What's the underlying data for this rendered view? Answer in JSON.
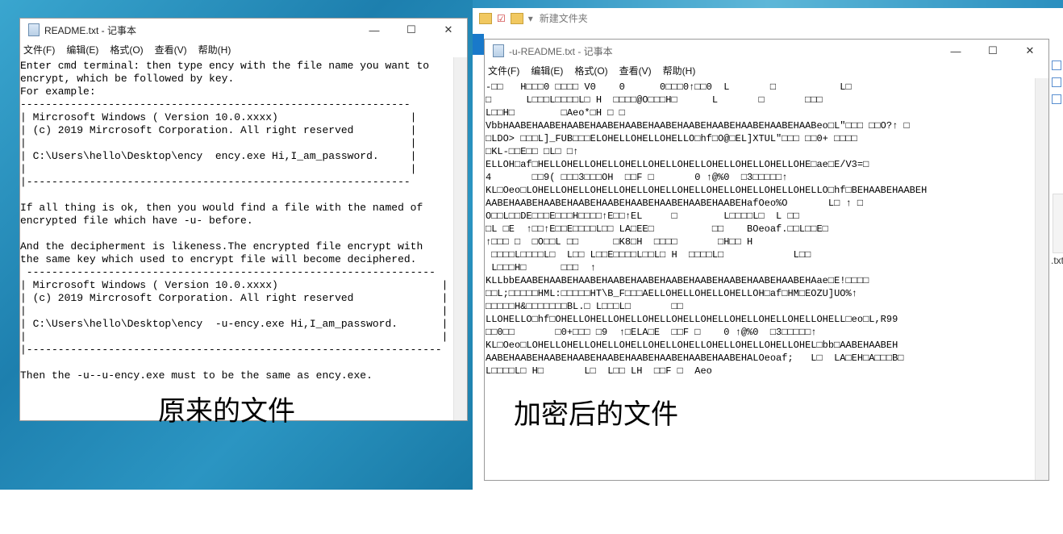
{
  "left_window": {
    "title": "README.txt - 记事本",
    "menu": [
      "文件(F)",
      "编辑(E)",
      "格式(O)",
      "查看(V)",
      "帮助(H)"
    ],
    "text": "Enter cmd terminal: then type ency with the file name you want to\nencrypt, which be followed by key.\nFor example:\n--------------------------------------------------------------\n| Mircrosoft Windows ( Version 10.0.xxxx)                     |\n| (c) 2019 Mircrosoft Corporation. All right reserved         |\n|                                                             |\n| C:\\Users\\hello\\Desktop\\ency  ency.exe Hi,I_am_password.     |\n|                                                             |\n|-------------------------------------------------------------\n\nIf all thing is ok, then you would find a file with the named of\nencrypted file which have -u- before.\n\nAnd the decipherment is likeness.The encrypted file encrypt with\nthe same key which used to encrypt file will become deciphered.\n -----------------------------------------------------------------\n| Mircrosoft Windows ( Version 10.0.xxxx)                          |\n| (c) 2019 Mircrosoft Corporation. All right reserved              |\n|                                                                  |\n| C:\\Users\\hello\\Desktop\\ency  -u-ency.exe Hi,I_am_password.       |\n|                                                                  |\n|------------------------------------------------------------------\n\nThen the -u--u-ency.exe must to be the same as ency.exe.",
    "caption": "原来的文件"
  },
  "right_window": {
    "title": "-u-README.txt - 记事本",
    "menu": [
      "文件(F)",
      "编辑(E)",
      "格式(O)",
      "查看(V)",
      "帮助(H)"
    ],
    "text": "-□□   H□□□0 □□□□ V0    0      0□□□0↑□□0  L       □           L□\n□      L□□□L□□□□L□ H  □□□□@O□□□H□      L       □       □□□\nL□□H□        □Aeo*□H □ □\nVbbHAABEHAABEHAABEHAABEHAABEHAABEHAABEHAABEHAABEHAABEHAABeo□L\"□□□ □□O?↑ □\n□LDO> □□□L]_FUB□□□ELOHELLOHELLOHELLO□hf□O@□EL]XTUL\"□□□ □□0+ □□□□\n□KL-□□E□□ □L□ □↑\nELLOH□af□HELLOHELLOHELLOHELLOHELLOHELLOHELLOHELLOHELLOHE□ae□E/V3=□\n4       □□9( □□□3□□□OH  □□F □       0 ↑@%0  □3□□□□□↑\nKL□Oeo□LOHELLOHELLOHELLOHELLOHELLOHELLOHELLOHELLOHELLOHELLO□hf□BEHAABEHAABEH\nAABEHAABEHAABEHAABEHAABEHAABEHAABEHAABEHAABEHafOeo%O       L□ ↑ □\nO□□L□□DE□□□E□□□H□□□□↑E□□↑EL     □        L□□□□L□  L □□\n□L □E  ↑□□↑E□□E□□□□L□□ LA□EE□          □□    BOeoaf.□□L□□E□\n↑□□□ □  □O□□L □□      □K8□H  □□□□       □H□□ H\n □□□□L□□□□L□  L□□ L□□E□□□□L□□L□ H  □□□□L□            L□□\n L□□□H□      □□□  ↑\nKLLbbEAABEHAABEHAABEHAABEHAABEHAABEHAABEHAABEHAABEHAABEHAae□E!□□□□\n□□L;□□□□□HML:□□□□□HT\\B_F□□□AELLOHELLOHELLOHELLOH□af□HM□EOZU]UO%↑\n□□□□□H&□□□□□□□BL.□ L□□□L□       □□\nLLOHELLO□hf□OHELLOHELLOHELLOHELLOHELLOHELLOHELLOHELLOHELLOHELL□eo□L,R99\n□□0□□       □0+□□□ □9  ↑□ELA□E  □□F □    0 ↑@%0  □3□□□□□↑\nKL□Oeo□LOHELLOHELLOHELLOHELLOHELLOHELLOHELLOHELLOHELLOHEL□bb□AABEHAABEH\nAABEHAABEHAABEHAABEHAABEHAABEHAABEHAABEHAABEHALOeoaf;   L□  LA□EH□A□□□B□\nL□□□□L□ H□       L□  L□□ LH  □□F □  Aeo",
    "caption": "加密后的文件"
  },
  "explorer": {
    "title": "新建文件夹"
  },
  "right_strip": {
    "file_label": ".txt"
  },
  "window_buttons": {
    "minimize": "—",
    "maximize": "☐",
    "close": "✕"
  }
}
